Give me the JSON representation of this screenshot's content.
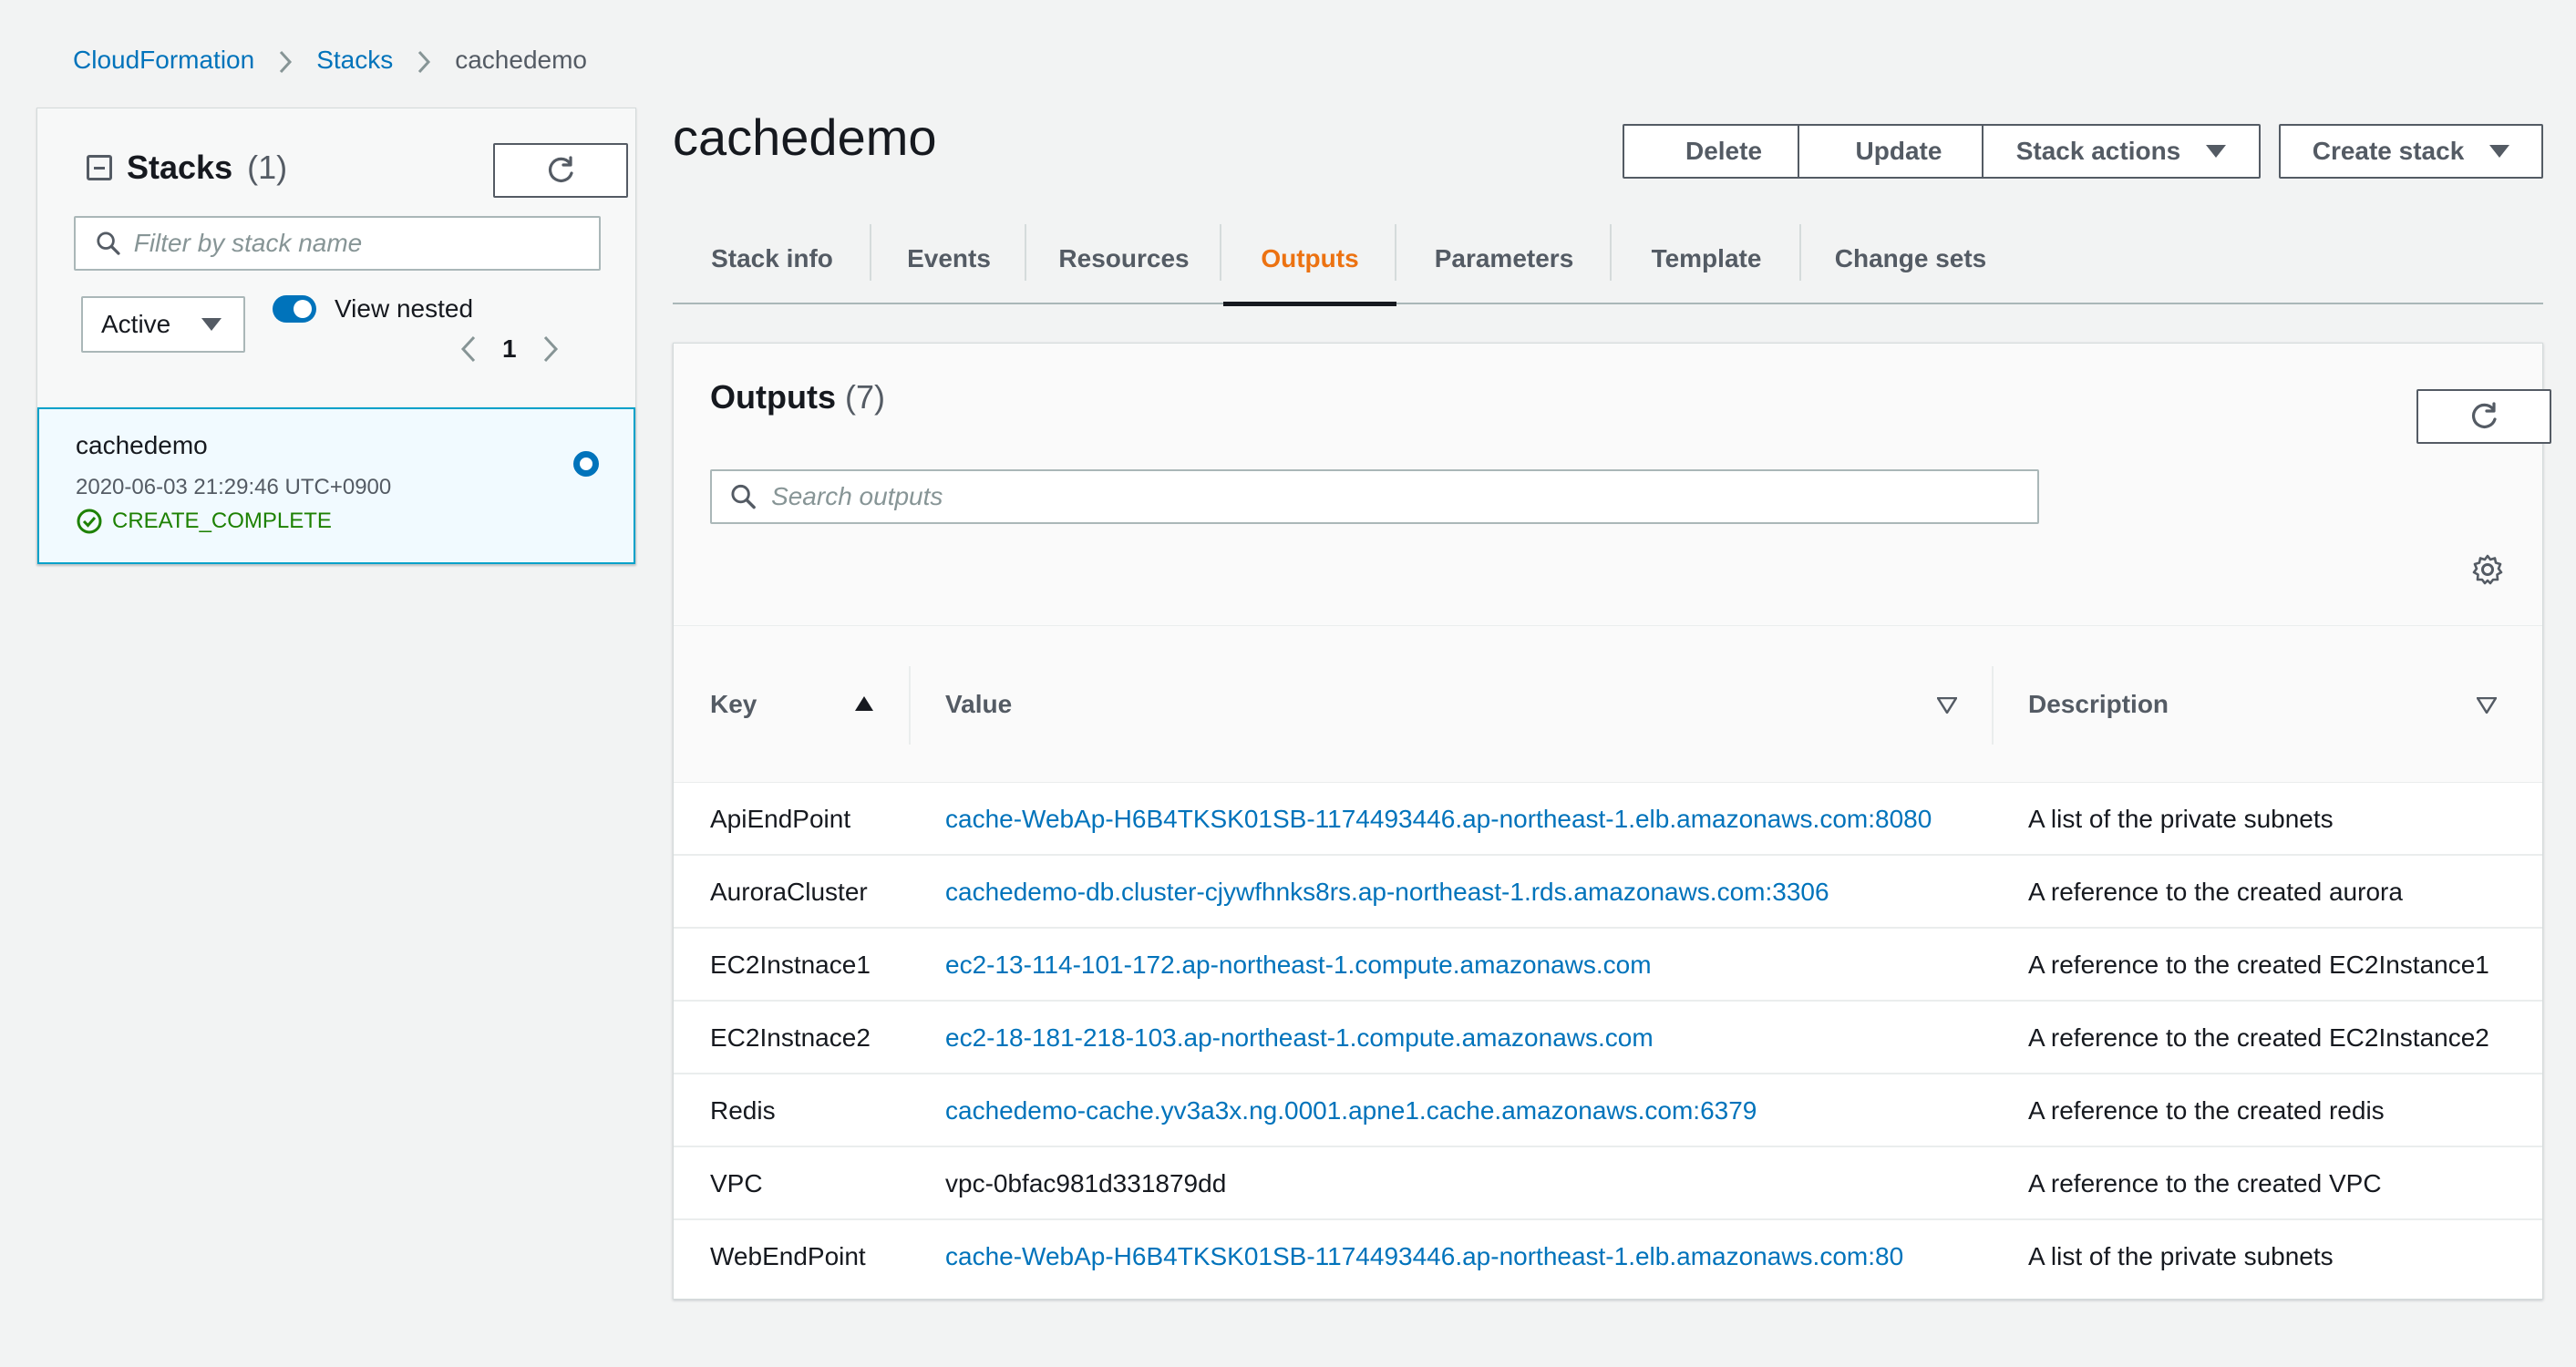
{
  "breadcrumb": {
    "items": [
      "CloudFormation",
      "Stacks",
      "cachedemo"
    ]
  },
  "stacks_panel": {
    "title": "Stacks",
    "count": "(1)",
    "filter_placeholder": "Filter by stack name",
    "status_filter": "Active",
    "view_nested_label": "View nested",
    "view_nested_on": true,
    "page": "1",
    "stack": {
      "name": "cachedemo",
      "timestamp": "2020-06-03 21:29:46 UTC+0900",
      "status": "CREATE_COMPLETE"
    }
  },
  "header": {
    "title": "cachedemo",
    "buttons": {
      "delete": "Delete",
      "update": "Update",
      "stack_actions": "Stack actions",
      "create_stack": "Create stack"
    }
  },
  "tabs": [
    "Stack info",
    "Events",
    "Resources",
    "Outputs",
    "Parameters",
    "Template",
    "Change sets"
  ],
  "active_tab": "Outputs",
  "outputs": {
    "title": "Outputs",
    "count": "(7)",
    "search_placeholder": "Search outputs",
    "columns": {
      "key": "Key",
      "value": "Value",
      "description": "Description"
    },
    "rows": [
      {
        "key": "ApiEndPoint",
        "value": "cache-WebAp-H6B4TKSK01SB-1174493446.ap-northeast-1.elb.amazonaws.com:8080",
        "description": "A list of the private subnets"
      },
      {
        "key": "AuroraCluster",
        "value": "cachedemo-db.cluster-cjywfhnks8rs.ap-northeast-1.rds.amazonaws.com:3306",
        "description": "A reference to the created aurora"
      },
      {
        "key": "EC2Instnace1",
        "value": "ec2-13-114-101-172.ap-northeast-1.compute.amazonaws.com",
        "description": "A reference to the created EC2Instance1"
      },
      {
        "key": "EC2Instnace2",
        "value": "ec2-18-181-218-103.ap-northeast-1.compute.amazonaws.com",
        "description": "A reference to the created EC2Instance2"
      },
      {
        "key": "Redis",
        "value": "cachedemo-cache.yv3a3x.ng.0001.apne1.cache.amazonaws.com:6379",
        "description": "A reference to the created redis"
      },
      {
        "key": "VPC",
        "value": "vpc-0bfac981d331879dd",
        "description": "A reference to the created VPC"
      },
      {
        "key": "WebEndPoint",
        "value": "cache-WebAp-H6B4TKSK01SB-1174493446.ap-northeast-1.elb.amazonaws.com:80",
        "description": "A list of the private subnets"
      }
    ]
  },
  "colors": {
    "link": "#0073bb",
    "active_tab": "#ec7211",
    "success": "#1d8102",
    "selected_bg": "#f1faff",
    "selected_border": "#00a1c9"
  }
}
